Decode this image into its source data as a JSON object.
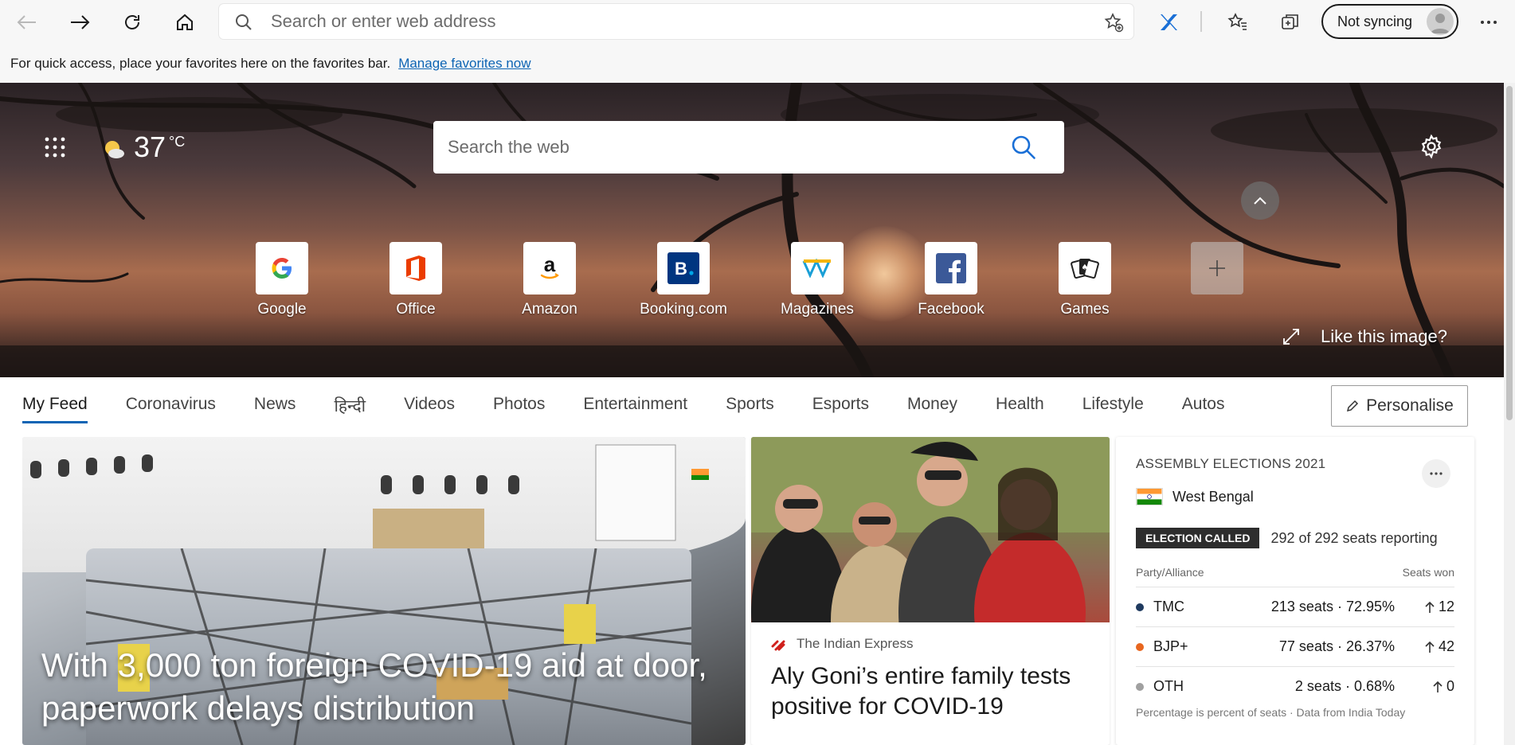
{
  "browser": {
    "address_placeholder": "Search or enter web address",
    "sync_label": "Not syncing"
  },
  "favorites_bar": {
    "message": "For quick access, place your favorites here on the favorites bar.",
    "link": "Manage favorites now"
  },
  "hero": {
    "temperature": "37",
    "unit": "°C",
    "search_placeholder": "Search the web",
    "tiles": [
      {
        "label": "Google"
      },
      {
        "label": "Office"
      },
      {
        "label": "Amazon"
      },
      {
        "label": "Booking.com"
      },
      {
        "label": "Magazines"
      },
      {
        "label": "Facebook"
      },
      {
        "label": "Games"
      }
    ],
    "like_image": "Like this image?"
  },
  "feed_tabs": {
    "items": [
      {
        "label": "My Feed"
      },
      {
        "label": "Coronavirus"
      },
      {
        "label": "News"
      },
      {
        "label": "हिन्दी"
      },
      {
        "label": "Videos"
      },
      {
        "label": "Photos"
      },
      {
        "label": "Entertainment"
      },
      {
        "label": "Sports"
      },
      {
        "label": "Esports"
      },
      {
        "label": "Money"
      },
      {
        "label": "Health"
      },
      {
        "label": "Lifestyle"
      },
      {
        "label": "Autos"
      }
    ],
    "personalise": "Personalise"
  },
  "cards": {
    "main": {
      "headline": "With 3,000 ton foreign COVID-19 aid at door, paperwork delays distribution"
    },
    "mid": {
      "source": "The Indian Express",
      "headline": "Aly Goni’s entire family tests positive for COVID-19"
    }
  },
  "elections": {
    "title": "ASSEMBLY ELECTIONS 2021",
    "state": "West Bengal",
    "badge": "ELECTION CALLED",
    "reporting": "292 of 292 seats reporting",
    "col_party": "Party/Alliance",
    "col_seats": "Seats won",
    "rows": [
      {
        "party": "TMC",
        "seats": "213 seats · 72.95%",
        "delta": "12",
        "color": "#1f3a5f"
      },
      {
        "party": "BJP+",
        "seats": "77 seats · 26.37%",
        "delta": "42",
        "color": "#e8661f"
      },
      {
        "party": "OTH",
        "seats": "2 seats · 0.68%",
        "delta": "0",
        "color": "#a0a0a0"
      }
    ],
    "note": "Percentage is percent of seats · Data from India Today"
  }
}
